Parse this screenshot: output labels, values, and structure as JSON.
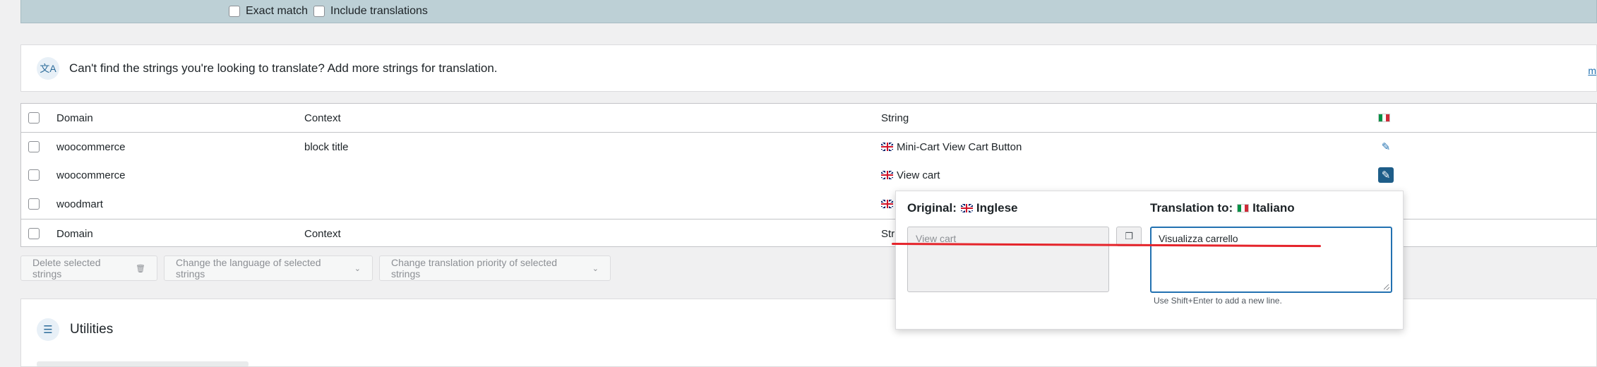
{
  "filters": {
    "exact_match_label": "Exact match",
    "include_translations_label": "Include translations"
  },
  "notice": {
    "icon": "translate-icon",
    "text": "Can't find the strings you're looking to translate? Add more strings for translation.",
    "more_link": "m"
  },
  "table": {
    "headers": {
      "domain": "Domain",
      "context": "Context",
      "string": "String"
    },
    "rows": [
      {
        "domain": "woocommerce",
        "context": "block title",
        "string": "Mini-Cart View Cart Button"
      },
      {
        "domain": "woocommerce",
        "context": "",
        "string": "View cart"
      },
      {
        "domain": "woodmart",
        "context": "",
        "string": ""
      }
    ],
    "footer": {
      "domain": "Domain",
      "context": "Context",
      "string": "Stri"
    }
  },
  "bulk_actions": {
    "delete_label": "Delete selected strings",
    "change_language_label": "Change the language of selected strings",
    "change_priority_label": "Change translation priority of selected strings"
  },
  "utilities": {
    "title": "Utilities"
  },
  "popup": {
    "original_label": "Original:",
    "original_language": "Inglese",
    "translation_label": "Translation to:",
    "translation_language": "Italiano",
    "original_value": "View cart",
    "translation_value": "Visualizza carrello",
    "hint": "Use Shift+Enter to add a new line."
  },
  "colors": {
    "accent": "#2271b1",
    "active_edit": "#1e5d88",
    "annotation_line": "#e5242b",
    "filter_bar": "#bdd0d6"
  }
}
